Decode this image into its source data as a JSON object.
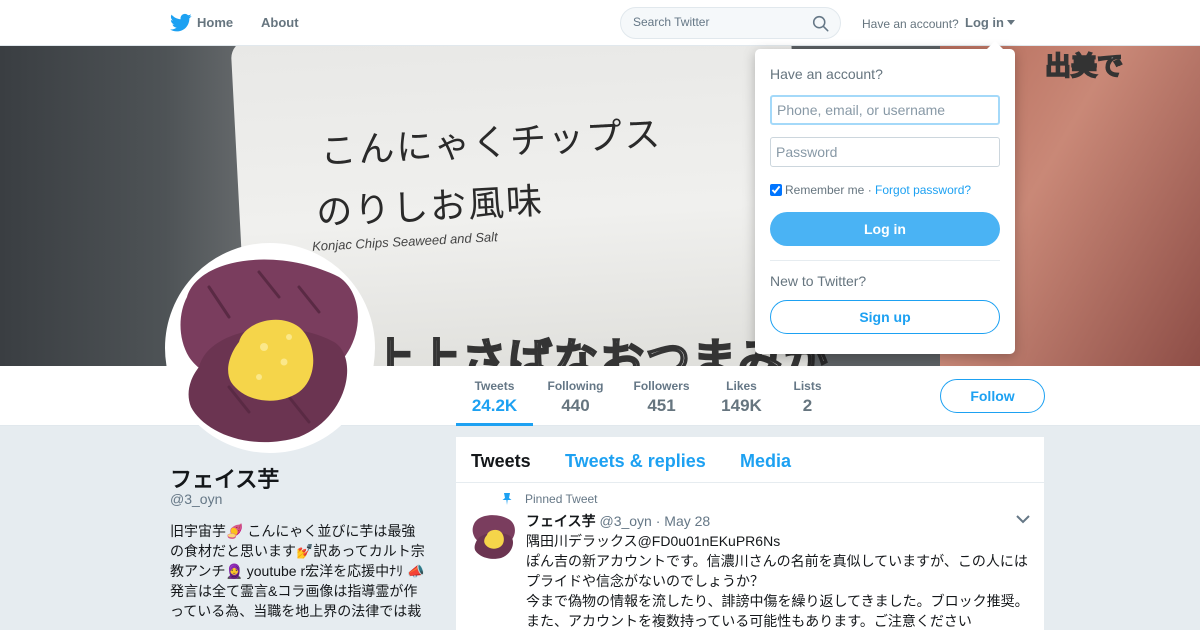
{
  "colors": {
    "accent": "#1da1f2",
    "background": "#e6ecf0",
    "text": "#14171a",
    "muted": "#657786"
  },
  "nav": {
    "logo_icon": "twitter-bird-icon",
    "home_label": "Home",
    "about_label": "About",
    "search_placeholder": "Search Twitter",
    "have_account": "Have an account?",
    "login_label": "Log in"
  },
  "banner": {
    "line1": "こんにゃくチップス",
    "line2": "のりしお風味",
    "subline": "Konjac Chips Seaweed and Salt",
    "caption": "上上さばなおつまみが",
    "corner": "出美で"
  },
  "profile": {
    "name": "フェイス芋",
    "handle": "@3_oyn",
    "bio_lines": [
      "旧宇宙芋🍠 こんにゃく並びに芋は最強",
      "の食材だと思います💅訳あってカルト宗",
      "教アンチ🧕 youtube r宏洋を応援中ﾅﾘ 📣",
      "発言は全て霊言&コラ画像は指導霊が作",
      "っている為、当職を地上界の法律では裁"
    ]
  },
  "stats": [
    {
      "label": "Tweets",
      "value": "24.2K"
    },
    {
      "label": "Following",
      "value": "440"
    },
    {
      "label": "Followers",
      "value": "451"
    },
    {
      "label": "Likes",
      "value": "149K"
    },
    {
      "label": "Lists",
      "value": "2"
    }
  ],
  "follow_label": "Follow",
  "timeline": {
    "tabs": [
      "Tweets",
      "Tweets & replies",
      "Media"
    ],
    "tweet": {
      "pinned_label": "Pinned Tweet",
      "name": "フェイス芋",
      "handle": "@3_oyn",
      "date": "May 28",
      "lines": [
        "隅田川デラックス@FD0u01nEKuPR6Ns",
        "ぽん吉の新アカウントです。信濃川さんの名前を真似していますが、この人には",
        "プライドや信念がないのでしょうか？",
        "今まで偽物の情報を流したり、誹謗中傷を繰り返してきました。ブロック推奨。",
        "また、アカウントを複数持っている可能性もあります。ご注意ください"
      ]
    }
  },
  "login_dropdown": {
    "title": "Have an account?",
    "username_placeholder": "Phone, email, or username",
    "password_placeholder": "Password",
    "remember_label": "Remember me",
    "separator": "·",
    "forgot_label": "Forgot password?",
    "login_button": "Log in",
    "new_to": "New to Twitter?",
    "signup_button": "Sign up"
  }
}
